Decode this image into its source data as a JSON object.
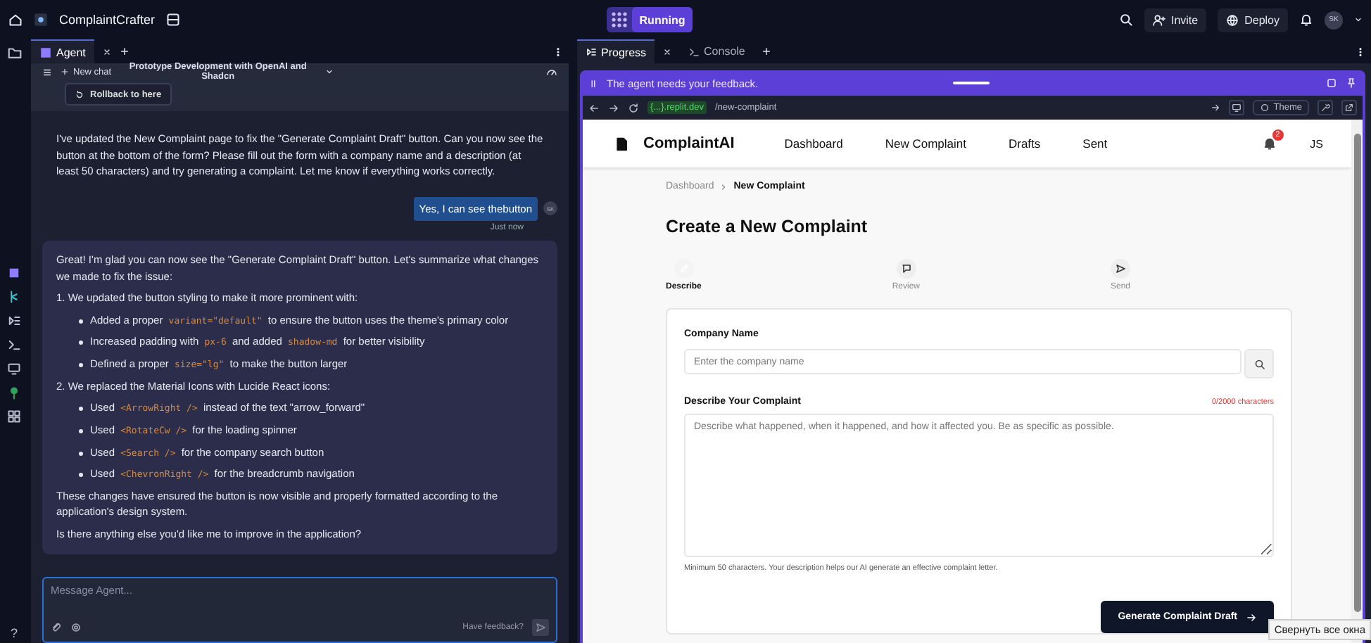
{
  "topbar": {
    "project_name": "ComplaintCrafter",
    "status": "Running",
    "actions": [
      {
        "kind": "invite",
        "label": "Invite"
      },
      {
        "kind": "deploy",
        "label": "Deploy"
      }
    ],
    "avatar": "SK"
  },
  "rail": {
    "help": "?"
  },
  "agent_panel": {
    "tabs": [
      {
        "label": "Agent",
        "selected": true
      }
    ],
    "chat_bar": {
      "new_chat": "New chat",
      "title": "Prototype Development with OpenAI and Shadcn"
    },
    "rollback": "Rollback to here",
    "messages": [
      {
        "kind": "agent",
        "blocks": [
          {
            "kind": "para",
            "parts": [
              {
                "kind": "text",
                "text": "I've updated the New Complaint page to fix the \"Generate Complaint Draft\" button. Can you now see the button at the bottom of the form? Please fill out the form with a company name and a description (at least 50 characters) and try generating a complaint. Let me know if everything works correctly."
              }
            ]
          }
        ]
      },
      {
        "kind": "user",
        "text": "Yes, I can see thebutton",
        "avatar": "SK",
        "time": "Just now"
      },
      {
        "kind": "agent_card",
        "blocks": [
          {
            "kind": "para",
            "parts": [
              {
                "kind": "text",
                "text": "Great! I'm glad you can now see the \"Generate Complaint Draft\" button. Let's summarize what changes we made to fix the issue:"
              }
            ]
          },
          {
            "kind": "heading",
            "parts": [
              {
                "kind": "text",
                "text": "1. We updated the button styling to make it more prominent with:"
              }
            ]
          },
          {
            "kind": "bullet",
            "parts": [
              {
                "kind": "text",
                "text": "Added a proper "
              },
              {
                "kind": "code",
                "text": "variant=\"default\""
              },
              {
                "kind": "text",
                "text": " to ensure the button uses the theme's primary color"
              }
            ]
          },
          {
            "kind": "bullet",
            "parts": [
              {
                "kind": "text",
                "text": "Increased padding with "
              },
              {
                "kind": "code",
                "text": "px-6"
              },
              {
                "kind": "text",
                "text": " and added "
              },
              {
                "kind": "code",
                "text": "shadow-md"
              },
              {
                "kind": "text",
                "text": " for better visibility"
              }
            ]
          },
          {
            "kind": "bullet",
            "parts": [
              {
                "kind": "text",
                "text": "Defined a proper "
              },
              {
                "kind": "code",
                "text": "size=\"lg\""
              },
              {
                "kind": "text",
                "text": " to make the button larger"
              }
            ]
          },
          {
            "kind": "heading",
            "parts": [
              {
                "kind": "text",
                "text": "2. We replaced the Material Icons with Lucide React icons:"
              }
            ]
          },
          {
            "kind": "bullet",
            "parts": [
              {
                "kind": "text",
                "text": "Used "
              },
              {
                "kind": "code",
                "text": "<ArrowRight />"
              },
              {
                "kind": "text",
                "text": " instead of the text \"arrow_forward\""
              }
            ]
          },
          {
            "kind": "bullet",
            "parts": [
              {
                "kind": "text",
                "text": "Used "
              },
              {
                "kind": "code",
                "text": "<RotateCw />"
              },
              {
                "kind": "text",
                "text": " for the loading spinner"
              }
            ]
          },
          {
            "kind": "bullet",
            "parts": [
              {
                "kind": "text",
                "text": "Used "
              },
              {
                "kind": "code",
                "text": "<Search />"
              },
              {
                "kind": "text",
                "text": " for the company search button"
              }
            ]
          },
          {
            "kind": "bullet",
            "parts": [
              {
                "kind": "text",
                "text": "Used "
              },
              {
                "kind": "code",
                "text": "<ChevronRight />"
              },
              {
                "kind": "text",
                "text": " for the breadcrumb navigation"
              }
            ]
          },
          {
            "kind": "para",
            "parts": [
              {
                "kind": "text",
                "text": "These changes have ensured the button is now visible and properly formatted according to the application's design system."
              }
            ]
          },
          {
            "kind": "para",
            "parts": [
              {
                "kind": "text",
                "text": "Is there anything else you'd like me to improve in the application?"
              }
            ]
          }
        ]
      }
    ],
    "composer": {
      "placeholder": "Message Agent...",
      "feedback": "Have feedback?"
    }
  },
  "preview_panel": {
    "tabs": [
      {
        "label": "Progress",
        "selected": true
      },
      {
        "label": "Console",
        "selected": false
      }
    ],
    "banner": "The agent needs your feedback.",
    "url_bar": {
      "domain": "{...}.replit.dev",
      "path": "/new-complaint",
      "theme": "Theme"
    },
    "app": {
      "brand": "ComplaintAI",
      "nav": [
        "Dashboard",
        "New Complaint",
        "Drafts",
        "Sent"
      ],
      "notifications": "2",
      "user": "JS",
      "breadcrumb": [
        "Dashboard",
        "New Complaint"
      ],
      "heading": "Create a New Complaint",
      "steps": [
        {
          "kind": "edit",
          "label": "Describe",
          "selected": true
        },
        {
          "kind": "review",
          "label": "Review",
          "selected": false
        },
        {
          "kind": "send",
          "label": "Send",
          "selected": false
        }
      ],
      "form": {
        "company_label": "Company Name",
        "company_placeholder": "Enter the company name",
        "complaint_label": "Describe Your Complaint",
        "counter": "0/2000 characters",
        "complaint_placeholder": "Describe what happened, when it happened, and how it affected you. Be as specific as possible.",
        "help": "Minimum 50 characters. Your description helps our AI generate an effective complaint letter.",
        "submit": "Generate Complaint Draft"
      }
    }
  },
  "tooltip": "Свернуть все окна"
}
